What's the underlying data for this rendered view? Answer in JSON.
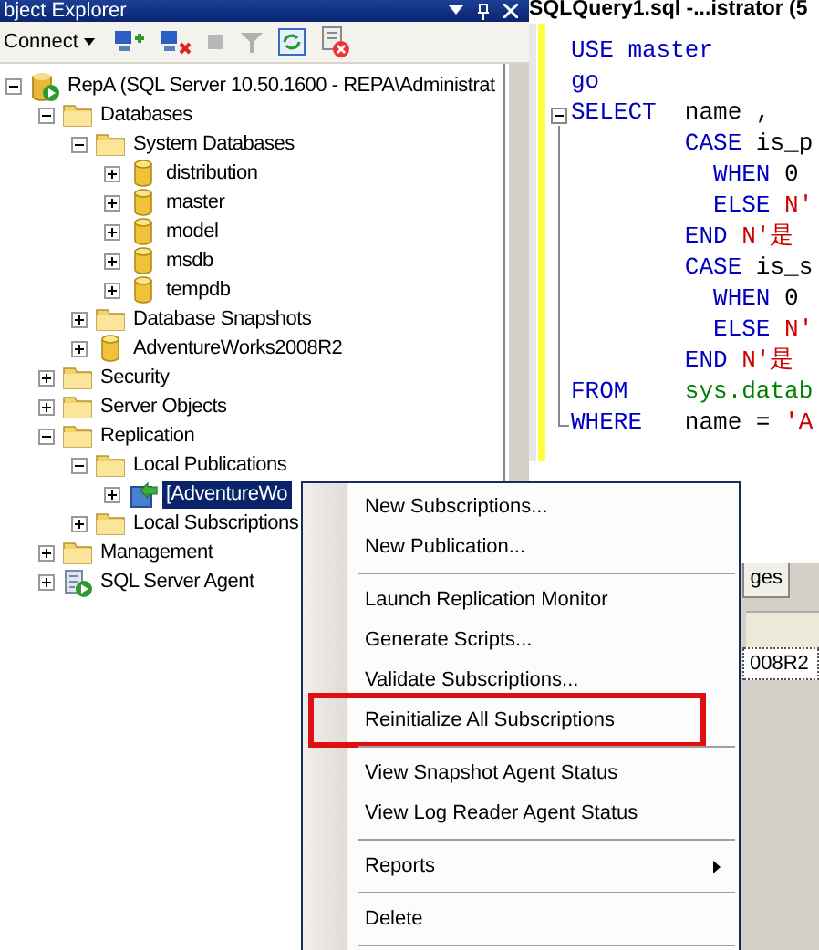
{
  "explorer": {
    "title": "bject Explorer",
    "toolbar": {
      "connect": "Connect"
    },
    "tree": [
      {
        "label": "RepA (SQL Server 10.50.1600 - REPA\\Administrat",
        "kind": "server",
        "expanded": true,
        "selected": false,
        "children": [
          {
            "label": "Databases",
            "kind": "folder",
            "expanded": true,
            "selected": false,
            "children": [
              {
                "label": "System Databases",
                "kind": "folder",
                "expanded": true,
                "selected": false,
                "children": [
                  {
                    "label": "distribution",
                    "kind": "database",
                    "expanded": false,
                    "selected": false
                  },
                  {
                    "label": "master",
                    "kind": "database",
                    "expanded": false,
                    "selected": false
                  },
                  {
                    "label": "model",
                    "kind": "database",
                    "expanded": false,
                    "selected": false
                  },
                  {
                    "label": "msdb",
                    "kind": "database",
                    "expanded": false,
                    "selected": false
                  },
                  {
                    "label": "tempdb",
                    "kind": "database",
                    "expanded": false,
                    "selected": false
                  }
                ]
              },
              {
                "label": "Database Snapshots",
                "kind": "folder",
                "expanded": false,
                "selected": false
              },
              {
                "label": "AdventureWorks2008R2",
                "kind": "database",
                "expanded": false,
                "selected": false
              }
            ]
          },
          {
            "label": "Security",
            "kind": "folder",
            "expanded": false,
            "selected": false
          },
          {
            "label": "Server Objects",
            "kind": "folder",
            "expanded": false,
            "selected": false
          },
          {
            "label": "Replication",
            "kind": "folder",
            "expanded": true,
            "selected": false,
            "children": [
              {
                "label": "Local Publications",
                "kind": "folder",
                "expanded": true,
                "selected": false,
                "children": [
                  {
                    "label": "[AdventureWo",
                    "kind": "publication",
                    "expanded": false,
                    "selected": true
                  }
                ]
              },
              {
                "label": "Local Subscriptions",
                "kind": "folder",
                "expanded": false,
                "selected": false
              }
            ]
          },
          {
            "label": "Management",
            "kind": "folder",
            "expanded": false,
            "selected": false
          },
          {
            "label": "SQL Server Agent",
            "kind": "agent",
            "expanded": false,
            "selected": false
          }
        ]
      }
    ]
  },
  "editor": {
    "tab": "SQLQuery1.sql -...istrator (5",
    "lines": [
      [
        {
          "kind": "keyword",
          "text": "USE master"
        }
      ],
      [
        {
          "kind": "keyword",
          "text": "go"
        }
      ],
      [
        {
          "kind": "keyword",
          "text": "SELECT"
        },
        {
          "kind": "plain",
          "text": "  name ,"
        }
      ],
      [
        {
          "kind": "keyword",
          "text": "        CASE"
        },
        {
          "kind": "plain",
          "text": " is_p"
        }
      ],
      [
        {
          "kind": "keyword",
          "text": "          WHEN"
        },
        {
          "kind": "plain",
          "text": " 0"
        }
      ],
      [
        {
          "kind": "keyword",
          "text": "          ELSE"
        },
        {
          "kind": "string",
          "text": " N'"
        }
      ],
      [
        {
          "kind": "keyword",
          "text": "        END"
        },
        {
          "kind": "string",
          "text": " N'是"
        }
      ],
      [
        {
          "kind": "keyword",
          "text": "        CASE"
        },
        {
          "kind": "plain",
          "text": " is_s"
        }
      ],
      [
        {
          "kind": "keyword",
          "text": "          WHEN"
        },
        {
          "kind": "plain",
          "text": " 0"
        }
      ],
      [
        {
          "kind": "keyword",
          "text": "          ELSE"
        },
        {
          "kind": "string",
          "text": " N'"
        }
      ],
      [
        {
          "kind": "keyword",
          "text": "        END"
        },
        {
          "kind": "string",
          "text": " N'是"
        }
      ],
      [
        {
          "kind": "keyword",
          "text": "FROM"
        },
        {
          "kind": "object",
          "text": "    sys.datab"
        }
      ],
      [
        {
          "kind": "keyword",
          "text": "WHERE"
        },
        {
          "kind": "plain",
          "text": "   name = "
        },
        {
          "kind": "string",
          "text": "'A"
        }
      ]
    ]
  },
  "results": {
    "tab": "ges",
    "cell": "008R2"
  },
  "context_menu": [
    {
      "kind": "item",
      "label": "New Subscriptions...",
      "highlighted": false
    },
    {
      "kind": "item",
      "label": "New Publication...",
      "highlighted": false
    },
    {
      "kind": "separator"
    },
    {
      "kind": "item",
      "label": "Launch Replication Monitor",
      "highlighted": false
    },
    {
      "kind": "item",
      "label": "Generate Scripts...",
      "highlighted": false
    },
    {
      "kind": "item",
      "label": "Validate Subscriptions...",
      "highlighted": false
    },
    {
      "kind": "item",
      "label": "Reinitialize All Subscriptions",
      "highlighted": true
    },
    {
      "kind": "separator"
    },
    {
      "kind": "item",
      "label": "View Snapshot Agent Status",
      "highlighted": false
    },
    {
      "kind": "item",
      "label": "View Log Reader Agent Status",
      "highlighted": false
    },
    {
      "kind": "separator"
    },
    {
      "kind": "submenu",
      "label": "Reports",
      "highlighted": false
    },
    {
      "kind": "separator"
    },
    {
      "kind": "item",
      "label": "Delete",
      "highlighted": false
    },
    {
      "kind": "separator"
    }
  ]
}
